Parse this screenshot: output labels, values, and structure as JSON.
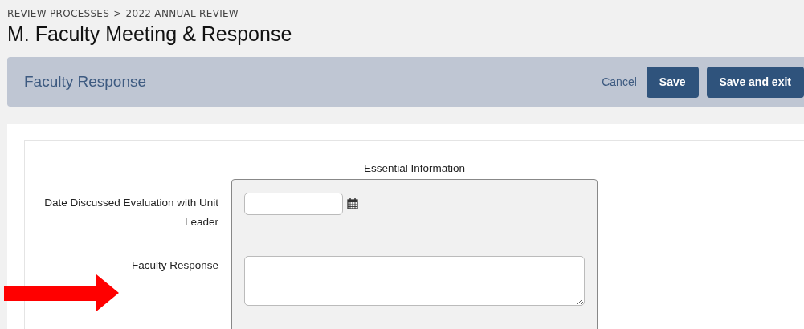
{
  "breadcrumb": [
    "REVIEW PROCESSES",
    ">",
    "2022 ANNUAL REVIEW"
  ],
  "title": "M. Faculty Meeting & Response",
  "header": {
    "title": "Faculty Response",
    "cancel": "Cancel",
    "buttons": [
      "Save",
      "Save and exit"
    ]
  },
  "section": {
    "heading": "Essential Information",
    "fields": [
      {
        "label": "Date Discussed Evaluation with Unit Leader",
        "kind": "date"
      },
      {
        "label": "Faculty Response",
        "kind": "textarea"
      }
    ]
  }
}
